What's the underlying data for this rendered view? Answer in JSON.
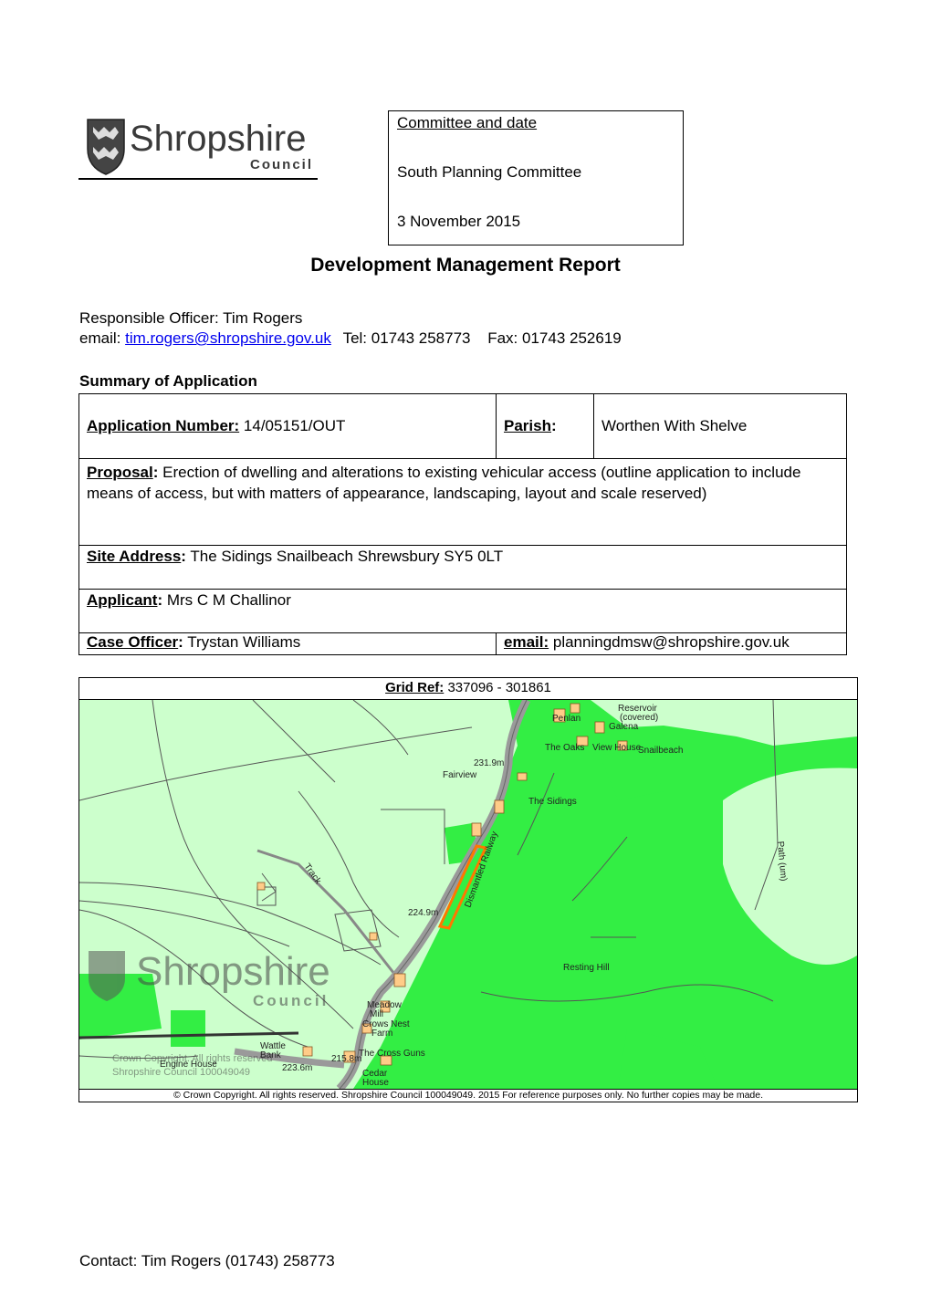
{
  "logo": {
    "name": "Shropshire",
    "sub": "Council"
  },
  "committee": {
    "heading": "Committee and date",
    "name": "South Planning Committee",
    "date": "3 November 2015"
  },
  "title": "Development Management Report",
  "officer": {
    "line": "Responsible Officer: Tim Rogers",
    "email_label": "email:",
    "email": "tim.rogers@shropshire.gov.uk",
    "tel": "Tel: 01743 258773",
    "fax": "Fax: 01743 252619"
  },
  "summary_heading": "Summary of Application",
  "application": {
    "number_label": "Application Number:",
    "number": "14/05151/OUT",
    "parish_label": "Parish",
    "parish": "Worthen With Shelve",
    "proposal_label": "Proposal",
    "proposal": "Erection of dwelling and alterations to existing vehicular access (outline application to include means of access, but with matters of appearance, landscaping, layout and scale reserved)",
    "site_label": "Site Address",
    "site": "The Sidings Snailbeach Shrewsbury SY5 0LT",
    "applicant_label": "Applicant",
    "applicant": "Mrs C M Challinor",
    "case_label": "Case Officer",
    "case_officer": "Trystan Williams",
    "email_label": "email:",
    "email": "planningdmsw@shropshire.gov.uk"
  },
  "map": {
    "grid_label": "Grid Ref:",
    "grid_value": "337096 - 301861",
    "labels": {
      "reservoir": "Reservoir",
      "covered": "(covered)",
      "penlan": "Penlan",
      "galena": "Galena",
      "the_oaks": "The Oaks",
      "view_house": "View House",
      "snailbeach": "Snailbeach",
      "h231": "231.9m",
      "fairview": "Fairview",
      "sidings": "The Sidings",
      "railway": "Dismantled Railway",
      "path": "Path (um)",
      "track": "Track",
      "h224": "224.9m",
      "resting_hill": "Resting Hill",
      "meadow": "Meadow",
      "mill": "Mill",
      "crows_nest": "Crows Nest",
      "farm": "Farm",
      "cross_guns": "The Cross Guns",
      "h215": "215.8m",
      "h223": "223.6m",
      "engine_house": "Engine House",
      "cedar": "Cedar",
      "house": "House",
      "wattle": "Wattle",
      "bank": "Bank",
      "wm_name": "Shropshire",
      "wm_sub": "Council",
      "wm_crown": "Crown Copyright. All rights reserved",
      "wm_licence": "Shropshire Council 100049049"
    },
    "copyright": "© Crown Copyright. All rights reserved.  Shropshire Council 100049049. 2015 For reference purposes only. No further copies may be made."
  },
  "contact": "Contact: Tim Rogers (01743) 258773",
  "colors": {
    "bright_green": "#33ee44",
    "pale_green": "#ccffcc",
    "link": "#0000ee"
  }
}
